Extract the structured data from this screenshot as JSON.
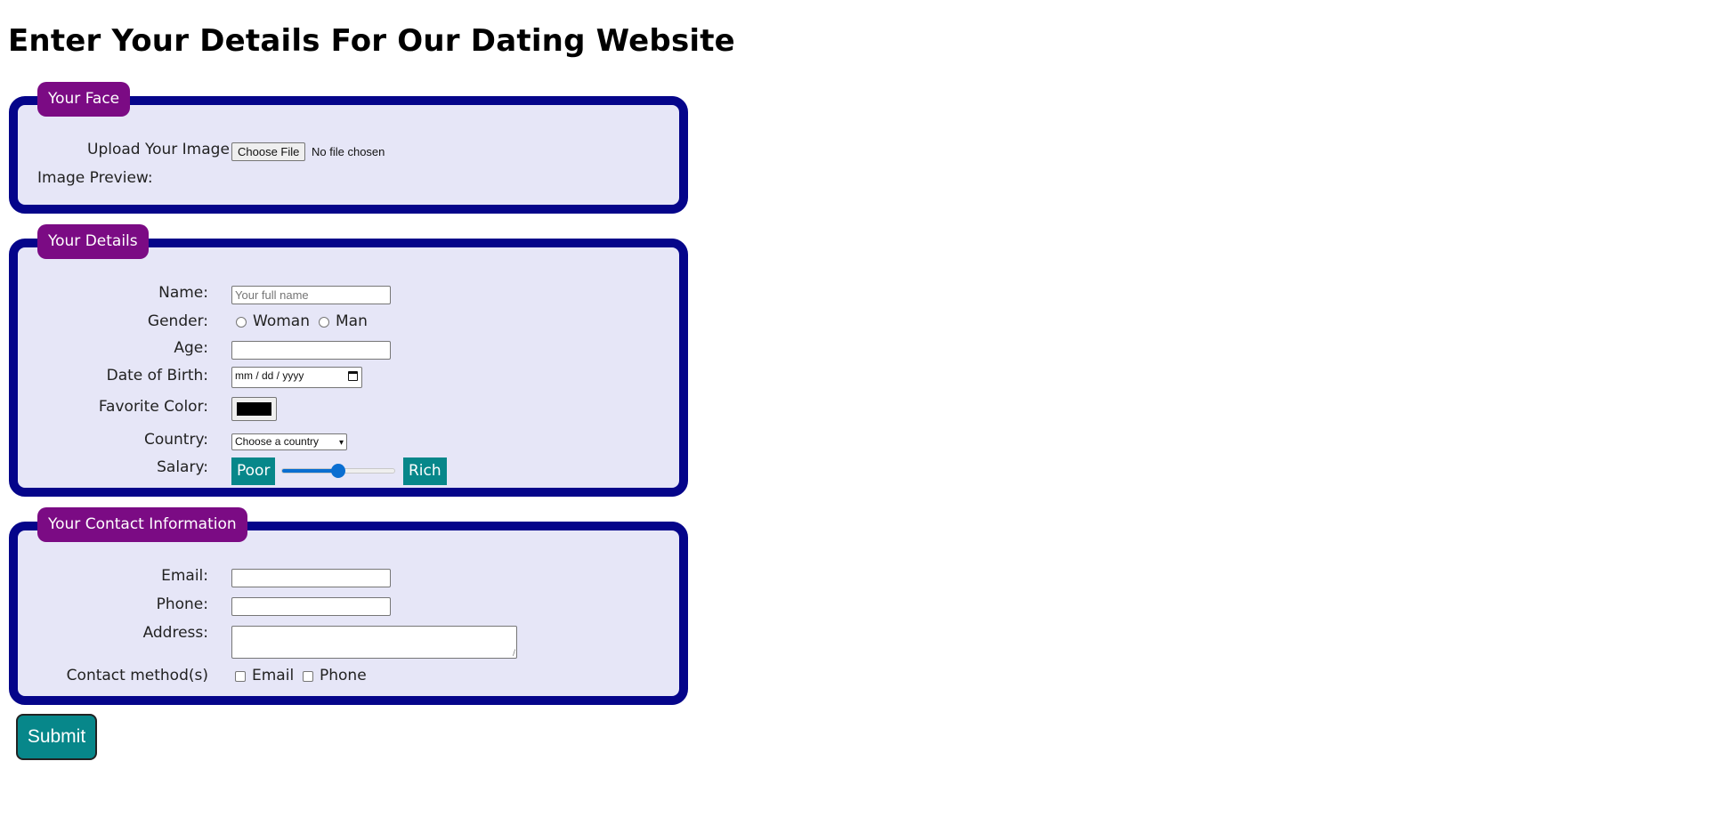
{
  "page_title": "Enter Your Details For Our Dating Website",
  "sections": {
    "face": {
      "legend": "Your Face",
      "upload_label": "Upload Your Image",
      "choose_file_button": "Choose File",
      "file_status": "No file chosen",
      "preview_label": "Image Preview:"
    },
    "details": {
      "legend": "Your Details",
      "name_label": "Name:",
      "name_placeholder": "Your full name",
      "gender_label": "Gender:",
      "gender_options": [
        "Woman",
        "Man"
      ],
      "age_label": "Age:",
      "age_value": "",
      "dob_label": "Date of Birth:",
      "dob_placeholder": "mm / dd / yyyy",
      "color_label": "Favorite Color:",
      "color_value": "#000000",
      "country_label": "Country:",
      "country_selected": "Choose a country",
      "salary_label": "Salary:",
      "salary_min_label": "Poor",
      "salary_max_label": "Rich",
      "salary_value_fraction": 0.5
    },
    "contact": {
      "legend": "Your Contact Information",
      "email_label": "Email:",
      "phone_label": "Phone:",
      "address_label": "Address:",
      "methods_label": "Contact method(s)",
      "method_options": [
        "Email",
        "Phone"
      ]
    }
  },
  "submit_label": "Submit",
  "colors": {
    "section_background": "#e6e6f7",
    "section_border": "#05058a",
    "legend_background": "#7b0b84",
    "accent_teal": "#07878a",
    "slider_blue": "#0a6ed1"
  }
}
